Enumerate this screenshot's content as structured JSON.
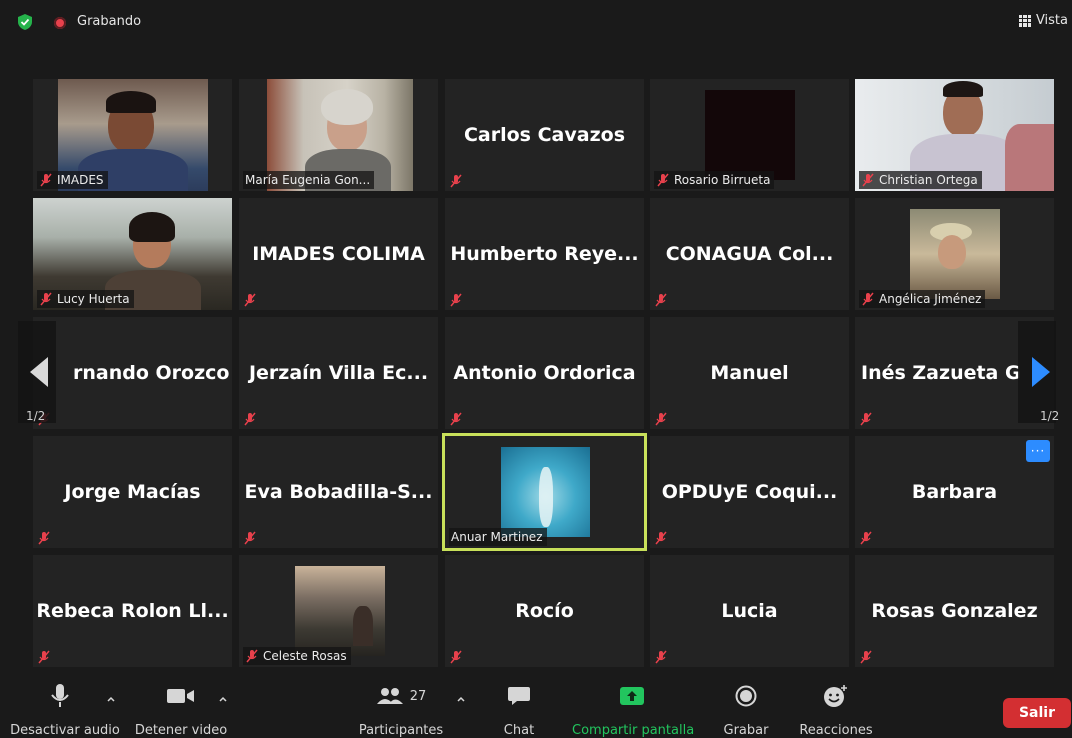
{
  "top": {
    "recording_label": "Grabando",
    "view_label": "Vista"
  },
  "tiles": {
    "imades": "IMADES",
    "maria": "María Eugenia Gon...",
    "carlos": "Carlos Cavazos",
    "rosario": "Rosario Birrueta",
    "christian": "Christian Ortega",
    "lucy": "Lucy Huerta",
    "imades_colima": "IMADES COLIMA",
    "humberto": "Humberto  Reye...",
    "conagua": "CONAGUA  Col...",
    "angelica": "Angélica Jiménez",
    "fernando": "rnando Orozco",
    "jerzain": "Jerzaín  Villa  Ec...",
    "antonio": "Antonio Ordorica",
    "manuel": "Manuel",
    "ines": "Inés  Zazueta  G",
    "jorge": "Jorge Macías",
    "eva": "Eva  Bobadilla-S...",
    "anuar": "Anuar Martinez",
    "opduye": "OPDUyE  Coqui...",
    "barbara": "Barbara",
    "rebeca": "Rebeca  Rolon  Ll...",
    "celeste": "Celeste Rosas",
    "rocio": "Rocío",
    "lucia": "Lucia",
    "rosas": "Rosas Gonzalez"
  },
  "pagination": {
    "left": "1/2",
    "right": "1/2"
  },
  "more_label": "···",
  "toolbar": {
    "audio": "Desactivar audio",
    "video": "Detener video",
    "participants": "Participantes",
    "participants_count": "27",
    "chat": "Chat",
    "share": "Compartir pantalla",
    "record": "Grabar",
    "reactions": "Reacciones",
    "leave": "Salir"
  },
  "colors": {
    "share_green": "#22c55e",
    "accent_blue": "#2d8cff",
    "leave_red": "#d32f32",
    "active_speaker": "#c8e05a",
    "muted_red": "#e8414c"
  }
}
